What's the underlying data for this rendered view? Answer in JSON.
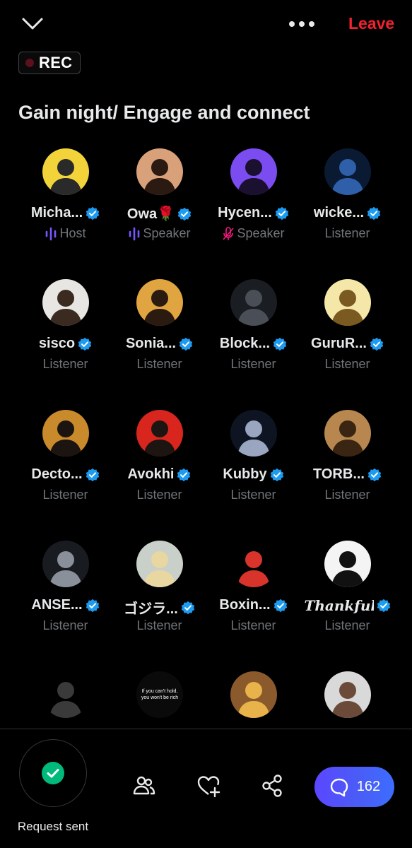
{
  "header": {
    "leave_label": "Leave",
    "rec_label": "REC",
    "space_title": "Gain night/ Engage and connect"
  },
  "participants": [
    {
      "name": "Micha...",
      "role": "Host",
      "role_icon": "sound-wave-icon",
      "avatar_bg": "#f2d43a",
      "avatar_fg": "#2a2a2a",
      "verified": true
    },
    {
      "name": "Owa🌹",
      "role": "Speaker",
      "role_icon": "sound-wave-icon",
      "avatar_bg": "#d9a17a",
      "avatar_fg": "#2b1a12",
      "verified": true
    },
    {
      "name": "Hycen...",
      "role": "Speaker",
      "role_icon": "mic-off-icon",
      "avatar_bg": "#7b4cf0",
      "avatar_fg": "#1c1030",
      "verified": true
    },
    {
      "name": "wicke...",
      "role": "Listener",
      "role_icon": "",
      "avatar_bg": "#0b1a33",
      "avatar_fg": "#2e5fa8",
      "verified": true
    },
    {
      "name": "sisco",
      "role": "Listener",
      "role_icon": "",
      "avatar_bg": "#e8e6e2",
      "avatar_fg": "#3b2a20",
      "verified": true
    },
    {
      "name": "Sonia...",
      "role": "Listener",
      "role_icon": "",
      "avatar_bg": "#e0a440",
      "avatar_fg": "#2a1a10",
      "verified": true
    },
    {
      "name": "Block...",
      "role": "Listener",
      "role_icon": "",
      "avatar_bg": "#1a1d22",
      "avatar_fg": "#4a4f57",
      "verified": true
    },
    {
      "name": "GuruR...",
      "role": "Listener",
      "role_icon": "",
      "avatar_bg": "#f5e7a8",
      "avatar_fg": "#7a5a20",
      "verified": true
    },
    {
      "name": "Decto...",
      "role": "Listener",
      "role_icon": "",
      "avatar_bg": "#c98a2c",
      "avatar_fg": "#1c1410",
      "verified": true
    },
    {
      "name": "Avokhi",
      "role": "Listener",
      "role_icon": "",
      "avatar_bg": "#d8261e",
      "avatar_fg": "#1d1512",
      "verified": true
    },
    {
      "name": "Kubby",
      "role": "Listener",
      "role_icon": "",
      "avatar_bg": "#0e1422",
      "avatar_fg": "#9aa6c0",
      "verified": true
    },
    {
      "name": "TORB...",
      "role": "Listener",
      "role_icon": "",
      "avatar_bg": "#b8874f",
      "avatar_fg": "#3a2412",
      "verified": true
    },
    {
      "name": "ANSE...",
      "role": "Listener",
      "role_icon": "",
      "avatar_bg": "#181b20",
      "avatar_fg": "#8a9099",
      "verified": true
    },
    {
      "name": "ゴジラ...",
      "role": "Listener",
      "role_icon": "",
      "avatar_bg": "#c9cfc9",
      "avatar_fg": "#e8d7a0",
      "verified": true
    },
    {
      "name": "Boxin...",
      "role": "Listener",
      "role_icon": "",
      "avatar_bg": "#000000",
      "avatar_fg": "#d8342c",
      "verified": true
    },
    {
      "name": "Thankful",
      "role": "Listener",
      "role_icon": "",
      "avatar_bg": "#f4f4f4",
      "avatar_fg": "#111111",
      "verified": true
    },
    {
      "name": "",
      "role": "",
      "role_icon": "",
      "avatar_bg": "#000000",
      "avatar_fg": "#3a3a3a",
      "verified": false
    },
    {
      "name": "",
      "role": "",
      "role_icon": "",
      "avatar_bg": "#0a0a0a",
      "avatar_fg": "#ffffff",
      "avatar_text": "If you can't hold, you won't be rich",
      "verified": false
    },
    {
      "name": "",
      "role": "",
      "role_icon": "",
      "avatar_bg": "#8a5a2c",
      "avatar_fg": "#e8b34a",
      "verified": false
    },
    {
      "name": "",
      "role": "",
      "role_icon": "",
      "avatar_bg": "#d9d9d9",
      "avatar_fg": "#6b4a3a",
      "verified": false
    }
  ],
  "footer": {
    "request_label": "Request sent",
    "chat_count": "162"
  },
  "colors": {
    "accent": "#1d9bf0",
    "leave": "#f4212e",
    "request_check": "#00ba7c",
    "speaker_wave": "#7856ff",
    "mic_off": "#f91880"
  }
}
